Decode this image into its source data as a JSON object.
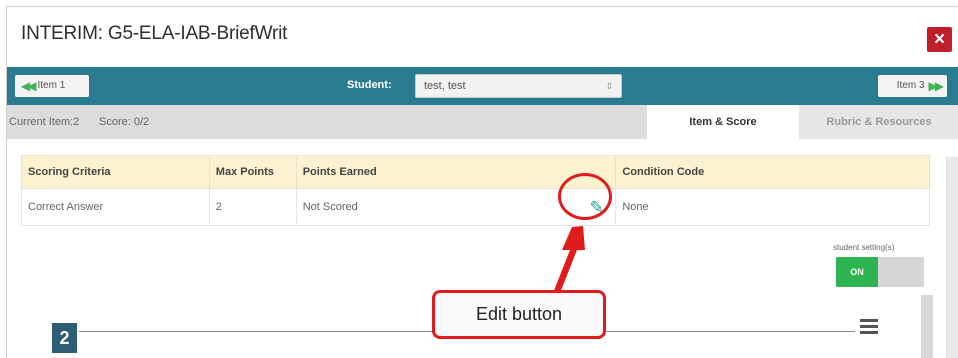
{
  "dialog": {
    "title": "INTERIM: G5-ELA-IAB-BriefWrit",
    "close_label": "×"
  },
  "nav": {
    "prev_label": "Item 1",
    "next_label": "Item 3",
    "student_label": "Student:",
    "student_value": "test, test"
  },
  "info": {
    "current_item": "Current Item:2",
    "score": "Score: 0/2"
  },
  "tabs": [
    {
      "label": "Item & Score",
      "active": true
    },
    {
      "label": "Rubric & Resources",
      "active": false
    }
  ],
  "scoring_table": {
    "headers": [
      "Scoring Criteria",
      "Max Points",
      "Points Earned",
      "Condition Code"
    ],
    "rows": [
      {
        "criteria": "Correct Answer",
        "max_points": "2",
        "points_earned": "Not Scored",
        "condition_code": "None"
      }
    ]
  },
  "student_settings": {
    "label": "student setting(s)",
    "toggle_on_label": "ON"
  },
  "item": {
    "number": "2"
  },
  "annotation": {
    "callout_text": "Edit button",
    "color": "#e01b1b"
  },
  "colors": {
    "nav_bar": "#2a7b8f",
    "close_button": "#c21e29",
    "table_header": "#fdf2d0",
    "toggle_on": "#2eb351",
    "item_badge": "#2c5f73"
  },
  "icons": {
    "edit": "pencil-icon",
    "close": "close-icon",
    "prev": "double-chevron-left-icon",
    "next": "double-chevron-right-icon",
    "menu": "hamburger-menu-icon"
  }
}
